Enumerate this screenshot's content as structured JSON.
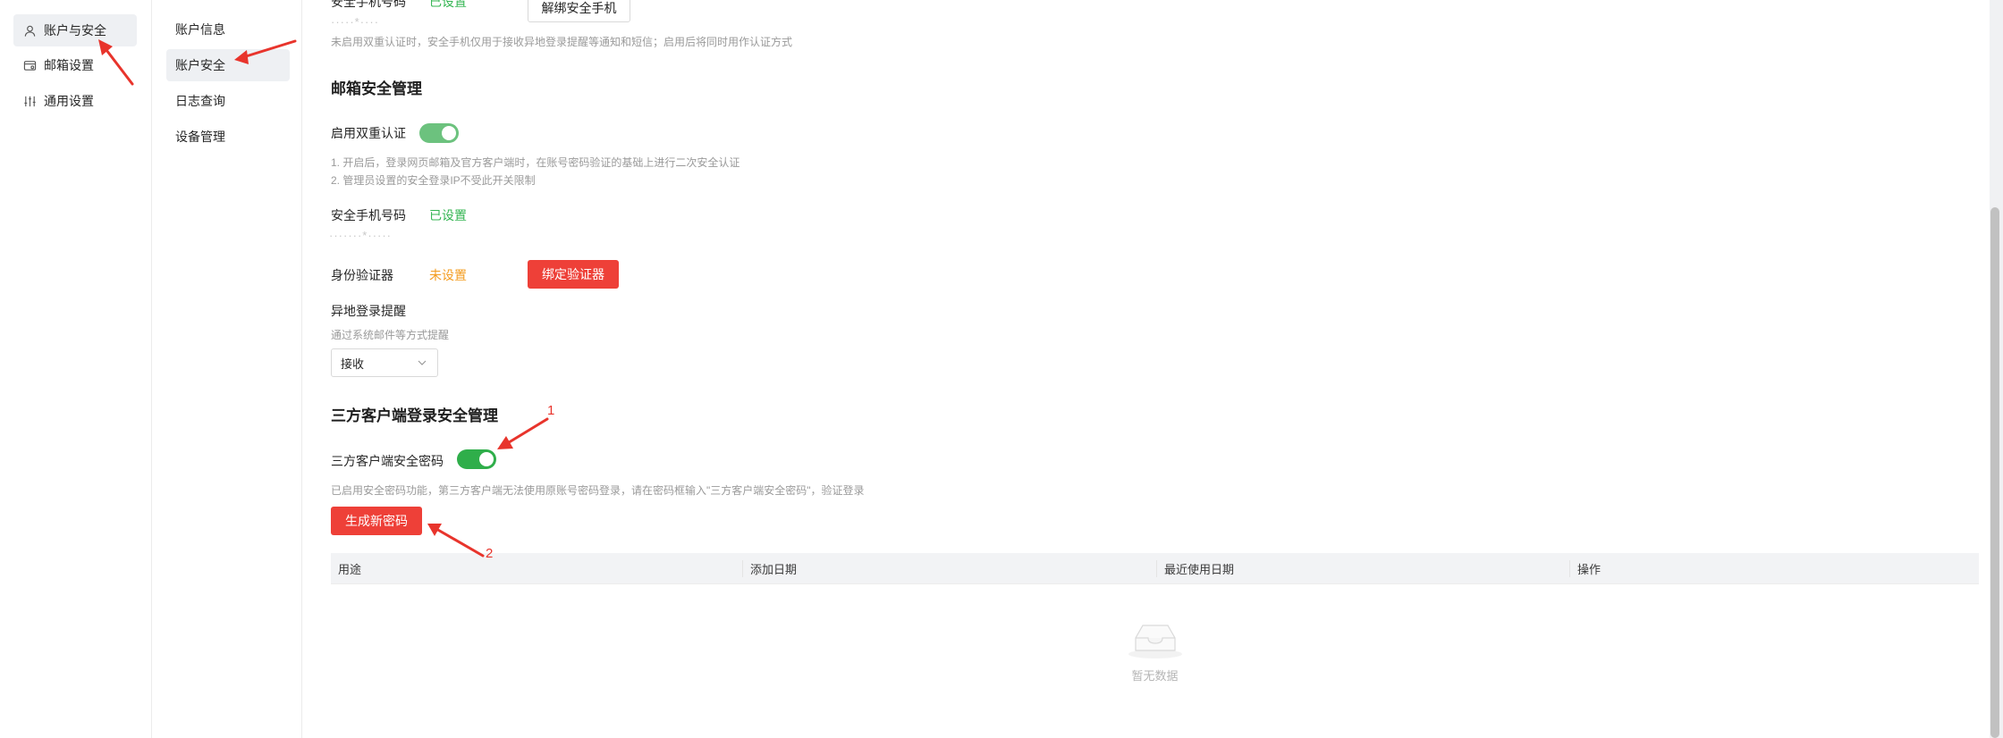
{
  "nav_primary": {
    "items": [
      {
        "label": "账户与安全",
        "icon": "user-icon",
        "active": true
      },
      {
        "label": "邮箱设置",
        "icon": "mailbox-icon",
        "active": false
      },
      {
        "label": "通用设置",
        "icon": "sliders-icon",
        "active": false
      }
    ]
  },
  "nav_secondary": {
    "items": [
      {
        "label": "账户信息",
        "active": false
      },
      {
        "label": "账户安全",
        "active": true
      },
      {
        "label": "日志查询",
        "active": false
      },
      {
        "label": "设备管理",
        "active": false
      }
    ]
  },
  "top_partial": {
    "phone_label": "安全手机号码",
    "phone_status": "已设置",
    "masked_value": "·····*····",
    "unbind_button": "解绑安全手机",
    "hint": "未启用双重认证时，安全手机仅用于接收异地登录提醒等通知和短信；启用后将同时用作认证方式"
  },
  "mailbox_security": {
    "title": "邮箱安全管理",
    "two_factor_label": "启用双重认证",
    "two_factor_enabled": true,
    "hint_1": "1. 开启后，登录网页邮箱及官方客户端时，在账号密码验证的基础上进行二次安全认证",
    "hint_2": "2. 管理员设置的安全登录IP不受此开关限制",
    "phone_label": "安全手机号码",
    "phone_status": "已设置",
    "phone_masked": "·······*·····",
    "authenticator_label": "身份验证器",
    "authenticator_status": "未设置",
    "bind_authenticator_button": "绑定验证器",
    "remote_login_label": "异地登录提醒",
    "remote_login_hint": "通过系统邮件等方式提醒",
    "remote_login_value": "接收"
  },
  "third_party": {
    "title": "三方客户端登录安全管理",
    "password_label": "三方客户端安全密码",
    "password_enabled": true,
    "hint": "已启用安全密码功能，第三方客户端无法使用原账号密码登录，请在密码框输入\"三方客户端安全密码\"，验证登录",
    "generate_button": "生成新密码",
    "table_headers": [
      "用途",
      "添加日期",
      "最近使用日期",
      "操作"
    ],
    "empty_text": "暂无数据"
  },
  "annotations": {
    "one": "1",
    "two": "2"
  },
  "colors": {
    "accent_red": "#ee4038",
    "success_green": "#34b552",
    "warning_orange": "#f39c1f",
    "arrow_red": "#e8342c"
  }
}
